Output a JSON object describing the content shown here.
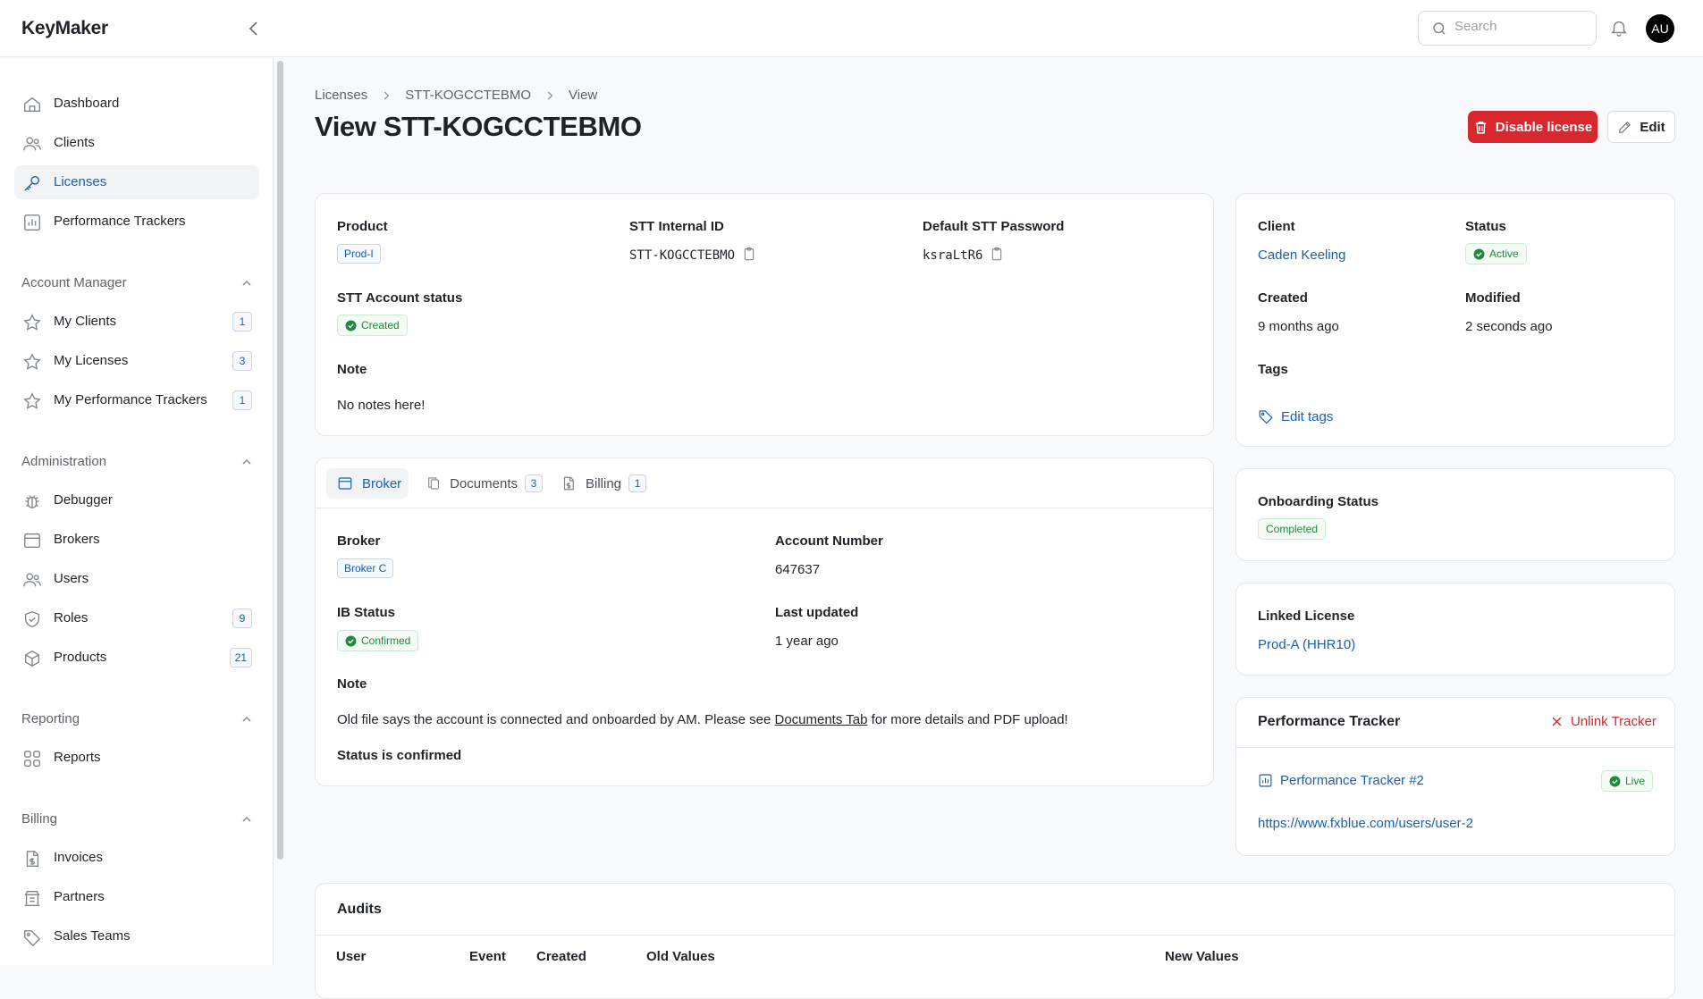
{
  "app": {
    "name": "KeyMaker"
  },
  "search": {
    "placeholder": "Search"
  },
  "user": {
    "initials": "AU"
  },
  "sidebar": {
    "main": [
      {
        "label": "Dashboard",
        "icon": "home-icon"
      },
      {
        "label": "Clients",
        "icon": "users-icon"
      },
      {
        "label": "Licenses",
        "icon": "key-icon",
        "active": true
      },
      {
        "label": "Performance Trackers",
        "icon": "chart-icon"
      }
    ],
    "account_manager": {
      "title": "Account Manager",
      "items": [
        {
          "label": "My Clients",
          "count": "1"
        },
        {
          "label": "My Licenses",
          "count": "3"
        },
        {
          "label": "My Performance Trackers",
          "count": "1"
        }
      ]
    },
    "administration": {
      "title": "Administration",
      "items": [
        {
          "label": "Debugger"
        },
        {
          "label": "Brokers"
        },
        {
          "label": "Users"
        },
        {
          "label": "Roles",
          "count": "9"
        },
        {
          "label": "Products",
          "count": "21"
        }
      ]
    },
    "reporting": {
      "title": "Reporting",
      "items": [
        {
          "label": "Reports"
        }
      ]
    },
    "billing": {
      "title": "Billing",
      "items": [
        {
          "label": "Invoices"
        },
        {
          "label": "Partners"
        },
        {
          "label": "Sales Teams"
        }
      ]
    }
  },
  "breadcrumb": [
    "Licenses",
    "STT-KOGCCTEBMO",
    "View"
  ],
  "page": {
    "title": "View STT-KOGCCTEBMO",
    "disable_label": "Disable license",
    "edit_label": "Edit"
  },
  "license": {
    "product_label": "Product",
    "product": "Prod-I",
    "internal_id_label": "STT Internal ID",
    "internal_id": "STT-KOGCCTEBMO",
    "password_label": "Default STT Password",
    "password": "ksraLtR6",
    "account_status_label": "STT Account status",
    "account_status": "Created",
    "note_label": "Note",
    "note": "No notes here!"
  },
  "tabs": [
    {
      "label": "Broker",
      "active": true
    },
    {
      "label": "Documents",
      "count": "3"
    },
    {
      "label": "Billing",
      "count": "1"
    }
  ],
  "broker": {
    "broker_label": "Broker",
    "broker": "Broker C",
    "account_label": "Account Number",
    "account": "647637",
    "ib_label": "IB Status",
    "ib_status": "Confirmed",
    "updated_label": "Last updated",
    "updated": "1 year ago",
    "note_label": "Note",
    "note_before": "Old file says the account is connected and onboarded by AM. Please see ",
    "note_link": "Documents Tab",
    "note_after": " for more details and PDF upload!",
    "note_bold": "Status is confirmed"
  },
  "details": {
    "client_label": "Client",
    "client": "Caden Keeling",
    "status_label": "Status",
    "status": "Active",
    "created_label": "Created",
    "created": "9 months ago",
    "modified_label": "Modified",
    "modified": "2 seconds ago",
    "tags_label": "Tags",
    "edit_tags": "Edit tags"
  },
  "onboarding": {
    "label": "Onboarding Status",
    "status": "Completed"
  },
  "linked": {
    "label": "Linked License",
    "value": "Prod-A (HHR10)"
  },
  "tracker": {
    "title": "Performance Tracker",
    "unlink": "Unlink Tracker",
    "name": "Performance Tracker #2",
    "status": "Live",
    "url": "https://www.fxblue.com/users/user-2"
  },
  "audits": {
    "title": "Audits",
    "columns": [
      "User",
      "Event",
      "Created",
      "Old Values",
      "New Values"
    ]
  },
  "colors": {
    "accent": "#1a5fb4",
    "danger": "#d9272e",
    "success": "#1e8a3d"
  }
}
